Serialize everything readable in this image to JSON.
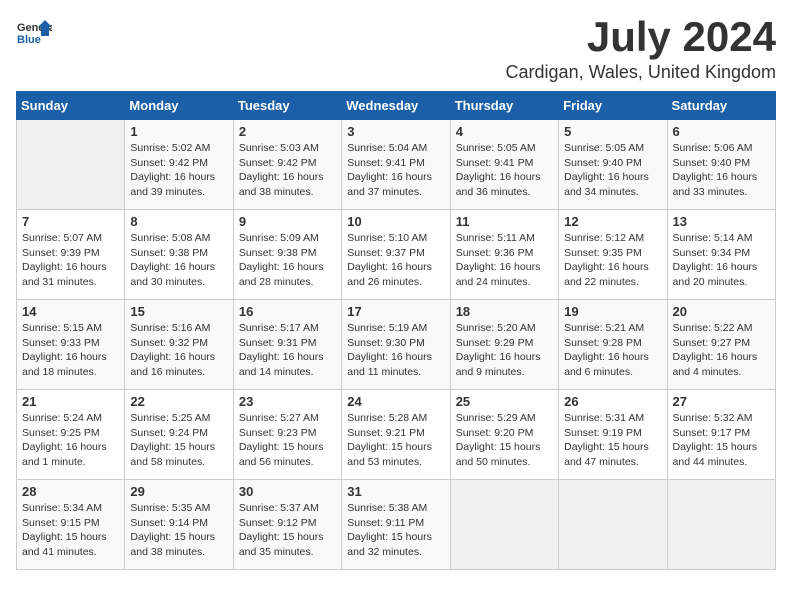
{
  "logo": {
    "general": "General",
    "blue": "Blue"
  },
  "header": {
    "month": "July 2024",
    "location": "Cardigan, Wales, United Kingdom"
  },
  "days_of_week": [
    "Sunday",
    "Monday",
    "Tuesday",
    "Wednesday",
    "Thursday",
    "Friday",
    "Saturday"
  ],
  "weeks": [
    [
      {
        "day": "",
        "info": ""
      },
      {
        "day": "1",
        "info": "Sunrise: 5:02 AM\nSunset: 9:42 PM\nDaylight: 16 hours\nand 39 minutes."
      },
      {
        "day": "2",
        "info": "Sunrise: 5:03 AM\nSunset: 9:42 PM\nDaylight: 16 hours\nand 38 minutes."
      },
      {
        "day": "3",
        "info": "Sunrise: 5:04 AM\nSunset: 9:41 PM\nDaylight: 16 hours\nand 37 minutes."
      },
      {
        "day": "4",
        "info": "Sunrise: 5:05 AM\nSunset: 9:41 PM\nDaylight: 16 hours\nand 36 minutes."
      },
      {
        "day": "5",
        "info": "Sunrise: 5:05 AM\nSunset: 9:40 PM\nDaylight: 16 hours\nand 34 minutes."
      },
      {
        "day": "6",
        "info": "Sunrise: 5:06 AM\nSunset: 9:40 PM\nDaylight: 16 hours\nand 33 minutes."
      }
    ],
    [
      {
        "day": "7",
        "info": "Sunrise: 5:07 AM\nSunset: 9:39 PM\nDaylight: 16 hours\nand 31 minutes."
      },
      {
        "day": "8",
        "info": "Sunrise: 5:08 AM\nSunset: 9:38 PM\nDaylight: 16 hours\nand 30 minutes."
      },
      {
        "day": "9",
        "info": "Sunrise: 5:09 AM\nSunset: 9:38 PM\nDaylight: 16 hours\nand 28 minutes."
      },
      {
        "day": "10",
        "info": "Sunrise: 5:10 AM\nSunset: 9:37 PM\nDaylight: 16 hours\nand 26 minutes."
      },
      {
        "day": "11",
        "info": "Sunrise: 5:11 AM\nSunset: 9:36 PM\nDaylight: 16 hours\nand 24 minutes."
      },
      {
        "day": "12",
        "info": "Sunrise: 5:12 AM\nSunset: 9:35 PM\nDaylight: 16 hours\nand 22 minutes."
      },
      {
        "day": "13",
        "info": "Sunrise: 5:14 AM\nSunset: 9:34 PM\nDaylight: 16 hours\nand 20 minutes."
      }
    ],
    [
      {
        "day": "14",
        "info": "Sunrise: 5:15 AM\nSunset: 9:33 PM\nDaylight: 16 hours\nand 18 minutes."
      },
      {
        "day": "15",
        "info": "Sunrise: 5:16 AM\nSunset: 9:32 PM\nDaylight: 16 hours\nand 16 minutes."
      },
      {
        "day": "16",
        "info": "Sunrise: 5:17 AM\nSunset: 9:31 PM\nDaylight: 16 hours\nand 14 minutes."
      },
      {
        "day": "17",
        "info": "Sunrise: 5:19 AM\nSunset: 9:30 PM\nDaylight: 16 hours\nand 11 minutes."
      },
      {
        "day": "18",
        "info": "Sunrise: 5:20 AM\nSunset: 9:29 PM\nDaylight: 16 hours\nand 9 minutes."
      },
      {
        "day": "19",
        "info": "Sunrise: 5:21 AM\nSunset: 9:28 PM\nDaylight: 16 hours\nand 6 minutes."
      },
      {
        "day": "20",
        "info": "Sunrise: 5:22 AM\nSunset: 9:27 PM\nDaylight: 16 hours\nand 4 minutes."
      }
    ],
    [
      {
        "day": "21",
        "info": "Sunrise: 5:24 AM\nSunset: 9:25 PM\nDaylight: 16 hours\nand 1 minute."
      },
      {
        "day": "22",
        "info": "Sunrise: 5:25 AM\nSunset: 9:24 PM\nDaylight: 15 hours\nand 58 minutes."
      },
      {
        "day": "23",
        "info": "Sunrise: 5:27 AM\nSunset: 9:23 PM\nDaylight: 15 hours\nand 56 minutes."
      },
      {
        "day": "24",
        "info": "Sunrise: 5:28 AM\nSunset: 9:21 PM\nDaylight: 15 hours\nand 53 minutes."
      },
      {
        "day": "25",
        "info": "Sunrise: 5:29 AM\nSunset: 9:20 PM\nDaylight: 15 hours\nand 50 minutes."
      },
      {
        "day": "26",
        "info": "Sunrise: 5:31 AM\nSunset: 9:19 PM\nDaylight: 15 hours\nand 47 minutes."
      },
      {
        "day": "27",
        "info": "Sunrise: 5:32 AM\nSunset: 9:17 PM\nDaylight: 15 hours\nand 44 minutes."
      }
    ],
    [
      {
        "day": "28",
        "info": "Sunrise: 5:34 AM\nSunset: 9:15 PM\nDaylight: 15 hours\nand 41 minutes."
      },
      {
        "day": "29",
        "info": "Sunrise: 5:35 AM\nSunset: 9:14 PM\nDaylight: 15 hours\nand 38 minutes."
      },
      {
        "day": "30",
        "info": "Sunrise: 5:37 AM\nSunset: 9:12 PM\nDaylight: 15 hours\nand 35 minutes."
      },
      {
        "day": "31",
        "info": "Sunrise: 5:38 AM\nSunset: 9:11 PM\nDaylight: 15 hours\nand 32 minutes."
      },
      {
        "day": "",
        "info": ""
      },
      {
        "day": "",
        "info": ""
      },
      {
        "day": "",
        "info": ""
      }
    ]
  ]
}
